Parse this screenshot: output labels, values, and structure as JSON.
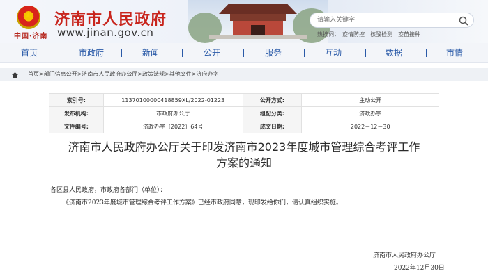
{
  "header": {
    "title": "济南市人民政府",
    "url": "www.jinan.gov.cn",
    "brand_script": "中国·济南",
    "search_placeholder": "请输入关键字",
    "hot_label": "热搜词：",
    "hot_terms": [
      "疫情防控",
      "核酸检测",
      "疫苗接种"
    ],
    "accent_color": "#c8251d"
  },
  "nav": {
    "items": [
      "首页",
      "市政府",
      "新闻",
      "公开",
      "服务",
      "互动",
      "数据",
      "市情"
    ],
    "color": "#2a5aa8"
  },
  "breadcrumb": {
    "path": "首页>部门信息公开>济南市人民政府办公厅>政策法规>其他文件>济府办字"
  },
  "info_table": {
    "rows": [
      {
        "k1": "索引号:",
        "v1": "11370100000418859XL/2022-01223",
        "k2": "公开方式:",
        "v2": "主动公开"
      },
      {
        "k1": "发布机构:",
        "v1": "市政府办公厅",
        "k2": "组配分类:",
        "v2": "济政办字"
      },
      {
        "k1": "文件编号:",
        "v1": "济政办字〔2022〕64号",
        "k2": "成文日期:",
        "v2": "2022－12－30"
      }
    ]
  },
  "document": {
    "title_line1": "济南市人民政府办公厅关于印发济南市2023年度城市管理综合考评工作",
    "title_line2": "方案的通知",
    "salutation": "各区县人民政府，市政府各部门（单位）：",
    "paragraph": "《济南市2023年度城市管理综合考评工作方案》已经市政府同意，现印发给你们，请认真组织实施。",
    "signature_org": "济南市人民政府办公厅",
    "signature_date": "2022年12月30日"
  }
}
